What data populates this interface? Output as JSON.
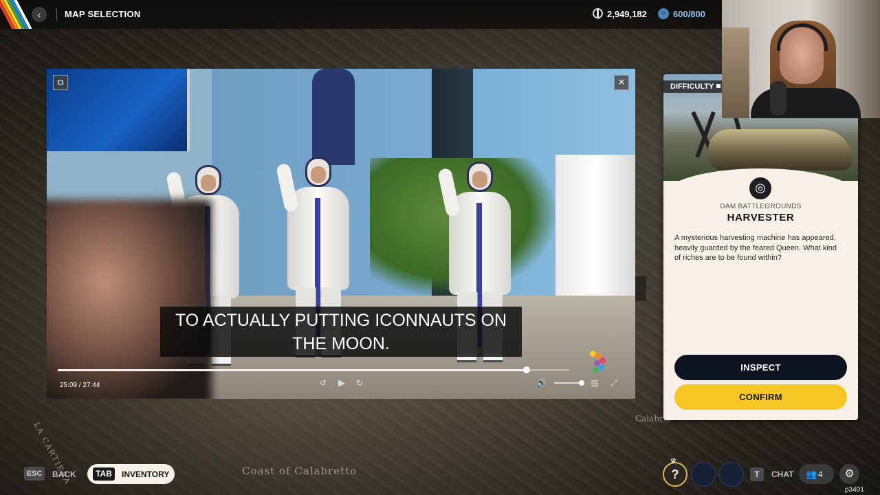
{
  "header": {
    "title": "MAP SELECTION",
    "back_icon": "chevron-left-icon",
    "coins": "2,949,182",
    "tokens": "600/800"
  },
  "video": {
    "subtitle": "TO ACTUALLY PUTTING ICONNAUTS ON THE MOON.",
    "timecode": "25:09 / 27:44",
    "progress": 0.9165
  },
  "mission_card": {
    "difficulty_label": "DIFFICULTY",
    "location": "DAM BATTLEGROUNDS",
    "title": "HARVESTER",
    "description": "A mysterious harvesting machine has appeared, heavily guarded by the feared Queen. What kind of riches are to be found within?",
    "inspect_label": "INSPECT",
    "confirm_label": "CONFIRM"
  },
  "map": {
    "label_left": "LA CARTIERA",
    "label_coast": "Coast of Calabretto",
    "label_right": "Calabria"
  },
  "footer": {
    "esc_key": "ESC",
    "back_label": "BACK",
    "tab_key": "TAB",
    "inventory_label": "INVENTORY",
    "help_glyph": "?",
    "t_key": "T",
    "chat_label": "CHAT",
    "party_count": "4",
    "build": "p3401"
  },
  "colors": {
    "accent_yellow": "#f6c624",
    "button_dark": "#0e1322",
    "card_bg": "#f6f0e6",
    "token_blue": "#8fc2e8"
  }
}
